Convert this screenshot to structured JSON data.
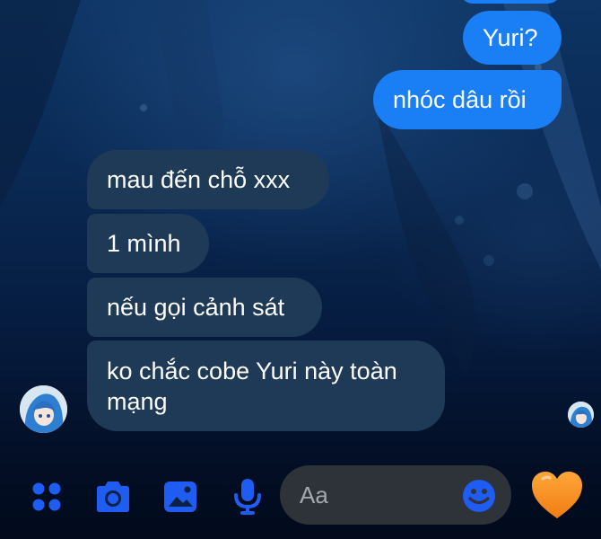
{
  "conversation": {
    "messages": [
      {
        "direction": "outgoing",
        "text": "Yuri?"
      },
      {
        "direction": "outgoing",
        "text": "nhóc dâu rồi"
      },
      {
        "direction": "incoming",
        "text": "mau đến chỗ xxx"
      },
      {
        "direction": "incoming",
        "text": "1 mình"
      },
      {
        "direction": "incoming",
        "text": "nếu gọi cảnh sát"
      },
      {
        "direction": "incoming",
        "text": "ko chắc cobe Yuri này toàn mạng"
      }
    ]
  },
  "composer": {
    "placeholder": "Aa",
    "icons": [
      "apps-grid-icon",
      "camera-icon",
      "gallery-icon",
      "microphone-icon",
      "emoji-icon",
      "heart-icon"
    ]
  },
  "theme": {
    "outgoing_bubble": "#1a7ef4",
    "incoming_bubble": "#1e3a57",
    "accent_icon": "#1f5cf2",
    "heart": "#f48a1c",
    "composer_bg": "#2e3239"
  }
}
